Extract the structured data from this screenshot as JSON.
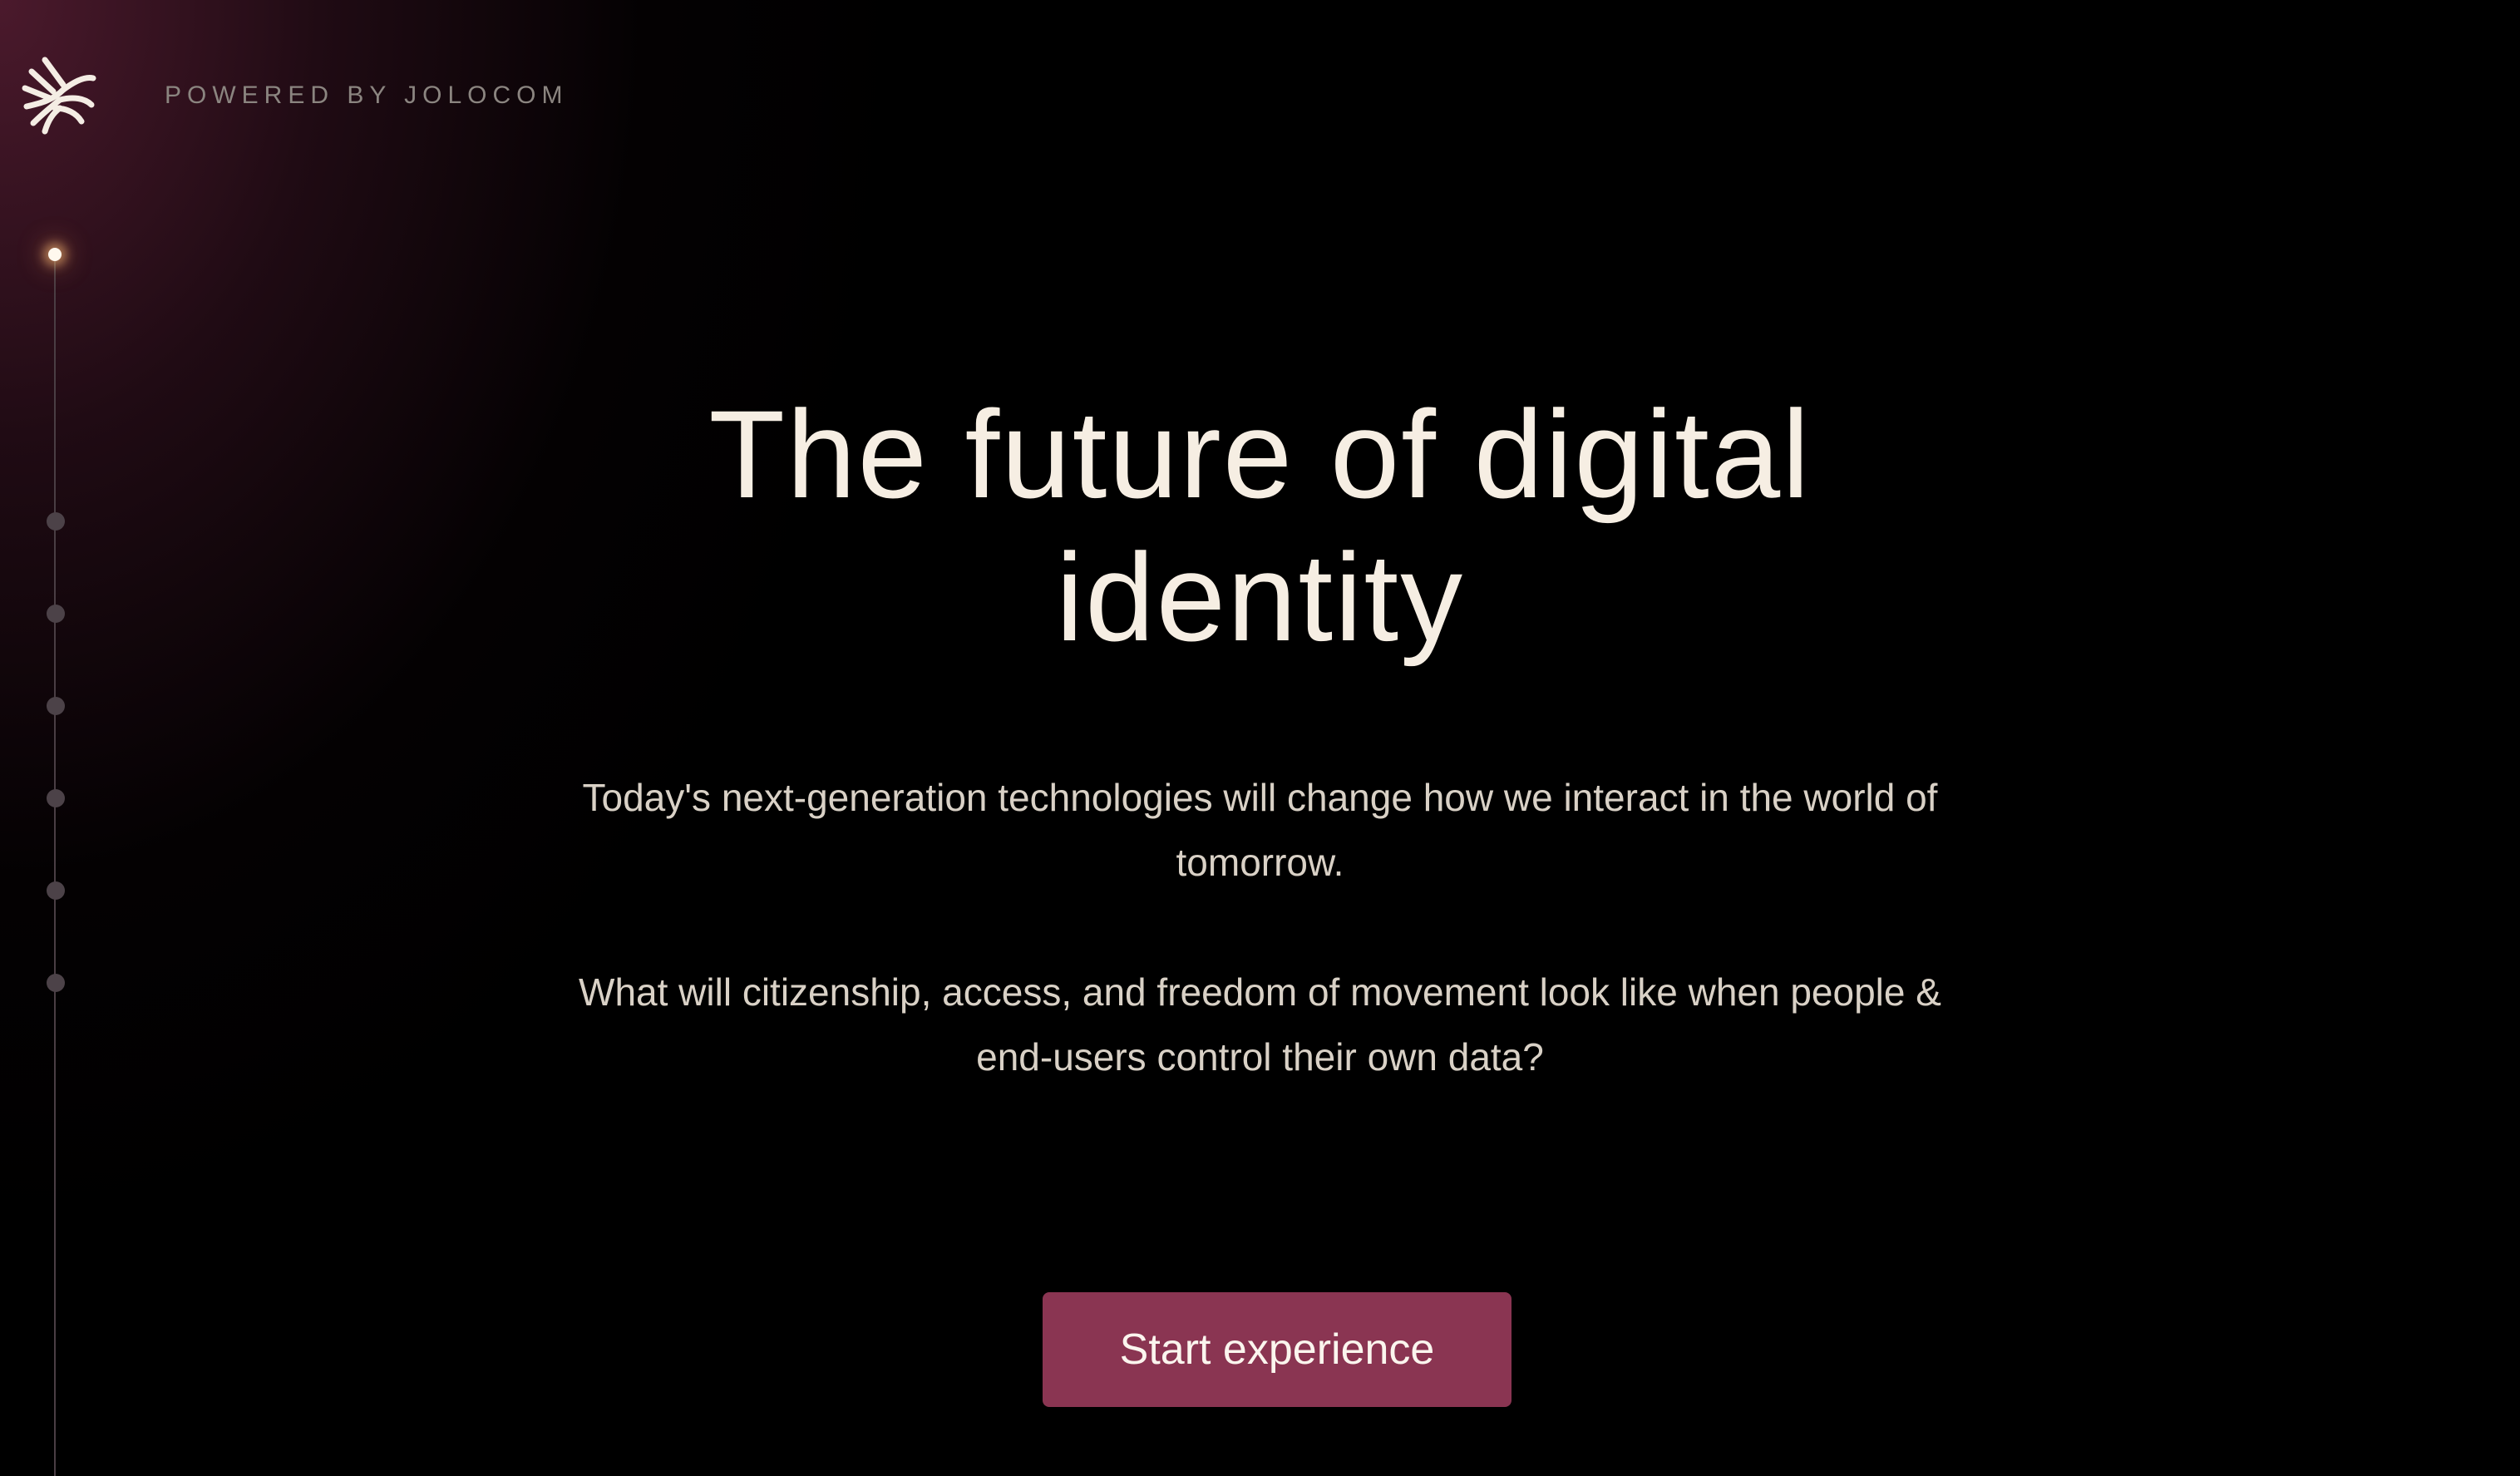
{
  "header": {
    "logo_icon": "jolocom-logo-icon",
    "powered_by": "POWERED BY JOLOCOM"
  },
  "timeline": {
    "active_step": 1,
    "total_steps": 7
  },
  "hero": {
    "headline": "The future of digital identity",
    "paragraph_1": "Today's next-generation technologies will change how we interact in the world of tomorrow.",
    "paragraph_2": "What will citizenship, access, and freedom of movement look like when people & end-users control their own data?"
  },
  "cta": {
    "label": "Start experience"
  },
  "colors": {
    "background": "#000000",
    "accent": "#8a3552",
    "text_primary": "#f6eee3",
    "text_secondary": "#d9d1c6",
    "brand_muted": "#8b8580"
  }
}
